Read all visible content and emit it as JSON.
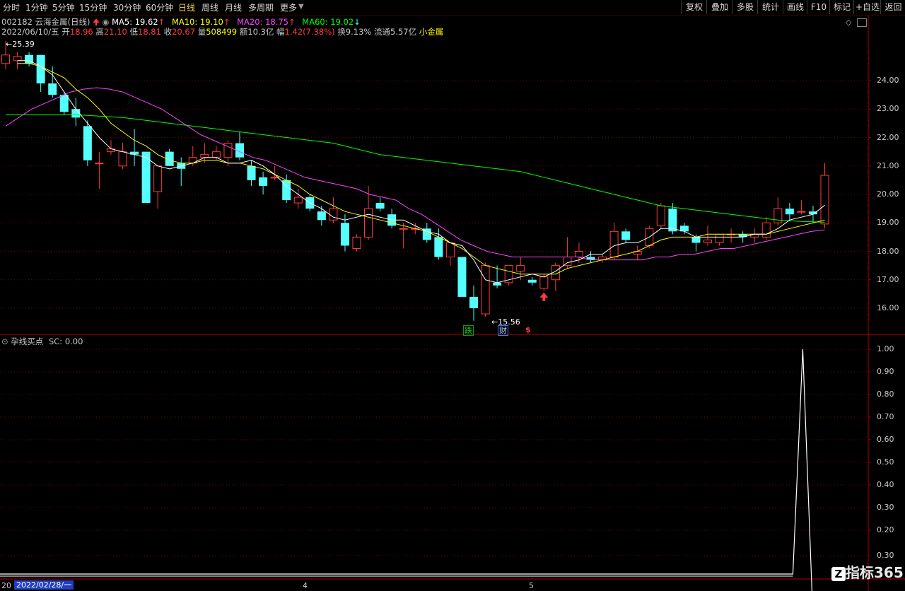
{
  "toolbar": {
    "periods": [
      "分时",
      "1分钟",
      "5分钟",
      "15分钟",
      "30分钟",
      "60分钟",
      "日线",
      "周线",
      "月线",
      "多周期",
      "更多"
    ],
    "active_period": "日线",
    "right_buttons": [
      "复权",
      "叠加",
      "多股",
      "统计",
      "画线",
      "F10",
      "标记",
      "+自选",
      "返回"
    ]
  },
  "header": {
    "code": "002182",
    "name": "云海金属(日线)",
    "ma5": "MA5: 19.62",
    "ma10": "MA10: 19.10",
    "ma20": "MA20: 18.75",
    "ma60": "MA60: 19.02",
    "date": "2022/06/10/五",
    "open_label": "开",
    "open": "18.96",
    "high_label": "高",
    "high": "21.10",
    "low_label": "低",
    "low": "18.81",
    "close_label": "收",
    "close": "20.67",
    "volume_label": "量",
    "volume": "508499",
    "amount_label": "额",
    "amount": "10.3亿",
    "change_label": "幅",
    "change": "1.42(7.38%)",
    "turnover": "换9.13%",
    "float_cap": "流通5.57亿",
    "sector": "小金属"
  },
  "main_chart": {
    "price_ticks": [
      "24.00",
      "23.00",
      "22.00",
      "21.00",
      "20.00",
      "19.00",
      "18.00",
      "17.00",
      "16.00"
    ],
    "max_label": "25.39",
    "min_label": "15.56",
    "badges": [
      "跌",
      "财",
      "$"
    ]
  },
  "indicator": {
    "name": "孕线买点",
    "value_text": "SC: 0.00",
    "ticks": [
      "1.00",
      "0.90",
      "0.80",
      "0.70",
      "0.60",
      "0.50",
      "0.40",
      "0.30",
      "0.20",
      "0.30"
    ]
  },
  "bottom": {
    "date_label": "2022/02/28/一",
    "left_stub": "20",
    "month_markers": [
      "4",
      "5"
    ]
  },
  "watermark": "指标365",
  "colors": {
    "up": "#ff3b3b",
    "down": "#54ffff",
    "ma5": "#ffffff",
    "ma10": "#ffff00",
    "ma20": "#ff44ff",
    "ma60": "#00ff00",
    "grid": "#7a0000"
  },
  "chart_data": {
    "type": "candlestick",
    "candles": [
      {
        "o": 24.6,
        "h": 25.39,
        "l": 24.4,
        "c": 24.9
      },
      {
        "o": 24.7,
        "h": 25.0,
        "l": 24.4,
        "c": 24.85
      },
      {
        "o": 24.9,
        "h": 25.0,
        "l": 24.5,
        "c": 24.6
      },
      {
        "o": 24.9,
        "h": 24.9,
        "l": 23.6,
        "c": 23.9
      },
      {
        "o": 23.9,
        "h": 24.5,
        "l": 23.4,
        "c": 23.5
      },
      {
        "o": 23.5,
        "h": 23.6,
        "l": 22.8,
        "c": 22.9
      },
      {
        "o": 23.0,
        "h": 23.4,
        "l": 22.4,
        "c": 22.7
      },
      {
        "o": 22.4,
        "h": 22.6,
        "l": 21.0,
        "c": 21.2
      },
      {
        "o": 21.1,
        "h": 21.5,
        "l": 20.2,
        "c": 21.1
      },
      {
        "o": 21.5,
        "h": 21.9,
        "l": 21.4,
        "c": 21.6
      },
      {
        "o": 21.0,
        "h": 21.8,
        "l": 20.9,
        "c": 21.5
      },
      {
        "o": 21.5,
        "h": 22.3,
        "l": 21.0,
        "c": 21.4
      },
      {
        "o": 21.5,
        "h": 21.5,
        "l": 19.7,
        "c": 19.7
      },
      {
        "o": 20.1,
        "h": 21.0,
        "l": 19.5,
        "c": 21.0
      },
      {
        "o": 21.5,
        "h": 21.6,
        "l": 21.0,
        "c": 21.0
      },
      {
        "o": 21.1,
        "h": 21.3,
        "l": 20.3,
        "c": 20.9
      },
      {
        "o": 21.1,
        "h": 21.7,
        "l": 21.0,
        "c": 21.3
      },
      {
        "o": 21.3,
        "h": 21.8,
        "l": 21.1,
        "c": 21.4
      },
      {
        "o": 21.3,
        "h": 21.7,
        "l": 21.2,
        "c": 21.5
      },
      {
        "o": 21.3,
        "h": 21.9,
        "l": 21.0,
        "c": 21.8
      },
      {
        "o": 21.8,
        "h": 22.2,
        "l": 21.2,
        "c": 21.3
      },
      {
        "o": 21.0,
        "h": 21.2,
        "l": 20.3,
        "c": 20.5
      },
      {
        "o": 20.6,
        "h": 20.8,
        "l": 20.0,
        "c": 20.3
      },
      {
        "o": 20.6,
        "h": 21.0,
        "l": 20.5,
        "c": 20.6
      },
      {
        "o": 20.5,
        "h": 20.7,
        "l": 19.7,
        "c": 19.8
      },
      {
        "o": 19.7,
        "h": 20.2,
        "l": 19.5,
        "c": 19.9
      },
      {
        "o": 19.9,
        "h": 20.0,
        "l": 19.4,
        "c": 19.5
      },
      {
        "o": 19.4,
        "h": 19.6,
        "l": 18.9,
        "c": 19.1
      },
      {
        "o": 19.1,
        "h": 19.9,
        "l": 19.0,
        "c": 19.5
      },
      {
        "o": 19.0,
        "h": 19.3,
        "l": 18.0,
        "c": 18.2
      },
      {
        "o": 18.1,
        "h": 18.6,
        "l": 18.0,
        "c": 18.5
      },
      {
        "o": 18.5,
        "h": 20.3,
        "l": 18.4,
        "c": 19.5
      },
      {
        "o": 19.7,
        "h": 19.9,
        "l": 19.4,
        "c": 19.5
      },
      {
        "o": 19.3,
        "h": 19.5,
        "l": 18.8,
        "c": 18.9
      },
      {
        "o": 18.8,
        "h": 19.0,
        "l": 18.1,
        "c": 18.8
      },
      {
        "o": 18.8,
        "h": 19.0,
        "l": 18.6,
        "c": 18.8
      },
      {
        "o": 18.8,
        "h": 19.0,
        "l": 18.3,
        "c": 18.4
      },
      {
        "o": 18.5,
        "h": 18.8,
        "l": 17.7,
        "c": 17.8
      },
      {
        "o": 17.8,
        "h": 18.3,
        "l": 17.5,
        "c": 18.3
      },
      {
        "o": 17.8,
        "h": 17.8,
        "l": 16.4,
        "c": 16.4
      },
      {
        "o": 16.4,
        "h": 16.8,
        "l": 15.56,
        "c": 16.0
      },
      {
        "o": 15.8,
        "h": 17.6,
        "l": 15.7,
        "c": 17.5
      },
      {
        "o": 16.9,
        "h": 17.5,
        "l": 16.7,
        "c": 16.8
      },
      {
        "o": 16.9,
        "h": 17.5,
        "l": 16.8,
        "c": 17.5
      },
      {
        "o": 17.3,
        "h": 17.8,
        "l": 17.0,
        "c": 17.5
      },
      {
        "o": 17.0,
        "h": 17.1,
        "l": 16.8,
        "c": 16.9
      },
      {
        "o": 16.7,
        "h": 17.2,
        "l": 16.6,
        "c": 17.1
      },
      {
        "o": 17.0,
        "h": 17.6,
        "l": 16.6,
        "c": 17.5
      },
      {
        "o": 17.5,
        "h": 18.5,
        "l": 17.4,
        "c": 17.8
      },
      {
        "o": 17.8,
        "h": 18.3,
        "l": 17.6,
        "c": 18.0
      },
      {
        "o": 17.8,
        "h": 18.0,
        "l": 17.6,
        "c": 17.7
      },
      {
        "o": 17.7,
        "h": 17.9,
        "l": 17.6,
        "c": 17.8
      },
      {
        "o": 17.8,
        "h": 19.0,
        "l": 17.7,
        "c": 18.7
      },
      {
        "o": 18.7,
        "h": 18.8,
        "l": 18.3,
        "c": 18.4
      },
      {
        "o": 17.9,
        "h": 18.2,
        "l": 17.7,
        "c": 18.0
      },
      {
        "o": 18.2,
        "h": 18.9,
        "l": 18.1,
        "c": 18.8
      },
      {
        "o": 18.9,
        "h": 19.7,
        "l": 18.8,
        "c": 19.6
      },
      {
        "o": 19.5,
        "h": 19.7,
        "l": 18.6,
        "c": 18.7
      },
      {
        "o": 18.9,
        "h": 19.0,
        "l": 18.6,
        "c": 18.7
      },
      {
        "o": 18.5,
        "h": 18.6,
        "l": 18.0,
        "c": 18.3
      },
      {
        "o": 18.3,
        "h": 18.9,
        "l": 18.2,
        "c": 18.4
      },
      {
        "o": 18.3,
        "h": 18.6,
        "l": 18.2,
        "c": 18.6
      },
      {
        "o": 18.6,
        "h": 18.8,
        "l": 18.3,
        "c": 18.6
      },
      {
        "o": 18.6,
        "h": 18.7,
        "l": 18.3,
        "c": 18.5
      },
      {
        "o": 18.5,
        "h": 18.8,
        "l": 18.3,
        "c": 18.6
      },
      {
        "o": 18.5,
        "h": 19.2,
        "l": 18.4,
        "c": 19.0
      },
      {
        "o": 19.0,
        "h": 19.9,
        "l": 18.9,
        "c": 19.5
      },
      {
        "o": 19.5,
        "h": 19.7,
        "l": 19.1,
        "c": 19.3
      },
      {
        "o": 19.4,
        "h": 19.8,
        "l": 19.3,
        "c": 19.4
      },
      {
        "o": 19.4,
        "h": 19.6,
        "l": 19.0,
        "c": 19.3
      },
      {
        "o": 18.96,
        "h": 21.1,
        "l": 18.81,
        "c": 20.67
      }
    ],
    "ma5": [
      24.7,
      24.7,
      24.5,
      24.2,
      23.6,
      23.0,
      22.5,
      22.0,
      21.6,
      21.5,
      21.4,
      21.3,
      21.0,
      20.9,
      21.0,
      21.1,
      21.3,
      21.3,
      21.1,
      21.1,
      21.2,
      21.0,
      20.7,
      20.3,
      20.0,
      19.7,
      19.5,
      19.2,
      19.1,
      19.2,
      19.3,
      19.2,
      19.1,
      19.1,
      18.9,
      18.7,
      18.6,
      18.3,
      18.2,
      17.7,
      17.0,
      16.9,
      17.0,
      17.1,
      17.2,
      17.1,
      17.3,
      17.6,
      17.7,
      17.9,
      17.9,
      18.2,
      18.3,
      18.3,
      18.5,
      18.8,
      18.8,
      18.7,
      18.5,
      18.5,
      18.5,
      18.5,
      18.5,
      18.6,
      18.6,
      18.8,
      19.1,
      19.2,
      19.3,
      19.62
    ],
    "ma10": [
      24.6,
      24.6,
      24.5,
      24.3,
      24.1,
      23.7,
      23.4,
      23.0,
      22.5,
      22.2,
      21.9,
      21.7,
      21.4,
      21.2,
      21.1,
      21.1,
      21.2,
      21.2,
      21.1,
      21.1,
      21.0,
      20.9,
      20.7,
      20.5,
      20.3,
      20.0,
      19.8,
      19.6,
      19.4,
      19.3,
      19.2,
      19.1,
      19.0,
      18.9,
      18.8,
      18.7,
      18.5,
      18.3,
      18.1,
      17.8,
      17.5,
      17.4,
      17.3,
      17.2,
      17.2,
      17.2,
      17.2,
      17.4,
      17.5,
      17.6,
      17.7,
      17.8,
      17.9,
      18.0,
      18.2,
      18.4,
      18.5,
      18.5,
      18.5,
      18.6,
      18.6,
      18.6,
      18.6,
      18.6,
      18.6,
      18.7,
      18.8,
      18.9,
      19.0,
      19.1
    ],
    "ma20": [
      22.4,
      22.7,
      23.0,
      23.2,
      23.4,
      23.6,
      23.7,
      23.75,
      23.7,
      23.6,
      23.4,
      23.2,
      23.0,
      22.7,
      22.4,
      22.1,
      21.9,
      21.7,
      21.5,
      21.3,
      21.2,
      21.0,
      20.8,
      20.6,
      20.5,
      20.4,
      20.3,
      20.2,
      20.0,
      19.9,
      19.8,
      19.5,
      19.3,
      19.0,
      18.7,
      18.4,
      18.2,
      18.0,
      17.9,
      17.8,
      17.8,
      17.8,
      17.8,
      17.8,
      17.8,
      17.7,
      17.7,
      17.7,
      17.7,
      17.7,
      17.8,
      17.8,
      17.9,
      17.9,
      18.0,
      18.1,
      18.1,
      18.2,
      18.3,
      18.4,
      18.5,
      18.6,
      18.7,
      18.75
    ],
    "ma60": [
      22.8,
      22.8,
      22.8,
      22.8,
      22.75,
      22.7,
      22.6,
      22.5,
      22.4,
      22.3,
      22.2,
      22.1,
      22.0,
      21.9,
      21.8,
      21.6,
      21.4,
      21.3,
      21.2,
      21.1,
      21.0,
      20.9,
      20.8,
      20.6,
      20.4,
      20.2,
      20.0,
      19.8,
      19.6,
      19.5,
      19.4,
      19.3,
      19.2,
      19.1,
      19.05,
      19.02
    ],
    "indicator_sc": {
      "last": 0.0,
      "peak": 1.0
    },
    "y_range": [
      15.56,
      25.39
    ]
  }
}
